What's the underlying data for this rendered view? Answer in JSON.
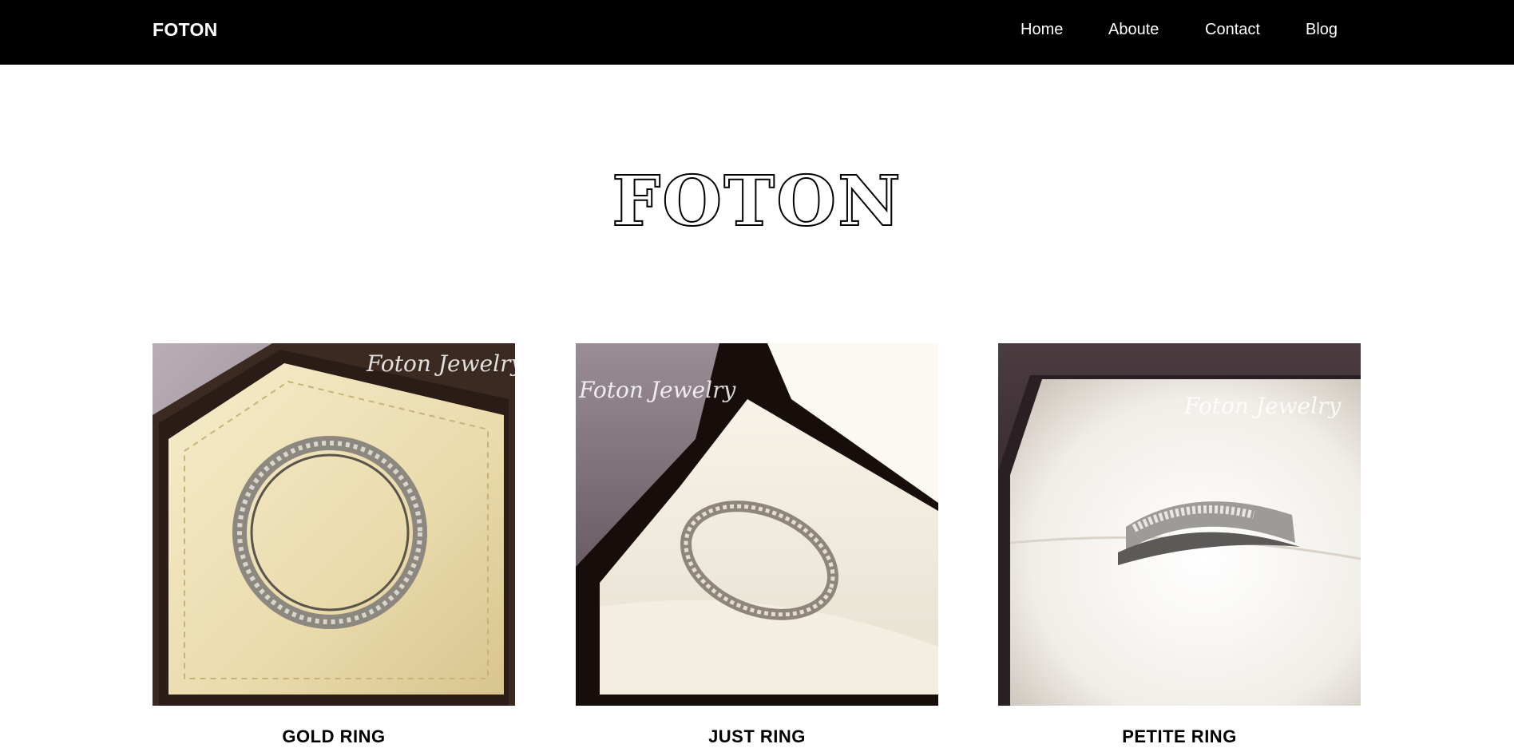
{
  "navbar": {
    "brand": "FOTON",
    "links": [
      "Home",
      "Aboute",
      "Contact",
      "Blog"
    ]
  },
  "hero": {
    "title": "FOTON"
  },
  "products": [
    {
      "name": "GOLD RING",
      "watermark": "Foton Jewelry"
    },
    {
      "name": "JUST RING",
      "watermark": "Foton Jewelry"
    },
    {
      "name": "PETITE RING",
      "watermark": "Foton Jewelry"
    }
  ],
  "colors": {
    "navbar": "#000000",
    "nav_text": "#ffffff",
    "page": "#ffffff",
    "text": "#000000"
  }
}
